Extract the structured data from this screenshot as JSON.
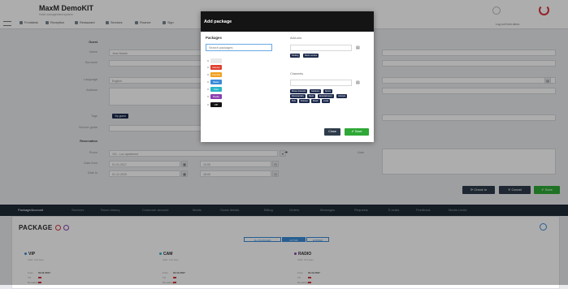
{
  "header": {
    "title": "MaxM DemoKIT",
    "subtitle": "Hotel management system",
    "nav": [
      "Frontdesk",
      "Reception",
      "Restaurant",
      "Services",
      "Finance",
      "Sign"
    ],
    "user_label": "Log out from demo"
  },
  "form": {
    "sections": {
      "guest": "Guest",
      "reservation": "Reservation"
    },
    "labels": {
      "name": "Name",
      "surname": "Surname",
      "language": "Language",
      "address": "Address",
      "tags": "Tags",
      "service_guide": "Service guide",
      "room": "Room",
      "date_from": "Date from",
      "date_to": "Date to",
      "note": "Note"
    },
    "values": {
      "name": "Jean Marek",
      "language": "English",
      "room": "101 - Lux apartment",
      "date_from": "01.01.2017",
      "date_to": "01.12.2020",
      "time_from": "12:00",
      "time_to": "18:00"
    },
    "tag_chip": "Vip guest"
  },
  "actions": {
    "checkin": "Check In",
    "cancel": "Cancel",
    "save": "Save"
  },
  "tabs": [
    "Package/Account",
    "Services",
    "Room history",
    "Customer account",
    "Meals",
    "Guest details",
    "Billing",
    "Orders",
    "Messages",
    "Requests",
    "E-mails",
    "Feedback",
    "Media Limits"
  ],
  "package": {
    "title": "PACKAGE",
    "filters": [
      "ALL PACKAGES",
      "ACTIVE",
      "EXPIRED"
    ],
    "cards": [
      {
        "name": "VIP",
        "color": "#3a8bd8",
        "sub": "Valid: 1/12 days",
        "rows": [
          {
            "k": "From",
            "v": "01.01.2017"
          },
          {
            "k": "TO"
          },
          {
            "k": "Remaining"
          }
        ]
      },
      {
        "name": "CAM",
        "color": "#2bb5c9",
        "sub": "Valid: 1/12 days",
        "rows": [
          {
            "k": "From",
            "v": "01.11.2017"
          },
          {
            "k": "TO"
          },
          {
            "k": "Remaining"
          }
        ]
      },
      {
        "name": "RADIO",
        "color": "#8b3fb0",
        "sub": "Valid: 1/12 days",
        "rows": [
          {
            "k": "From",
            "v": "01.11.2017"
          },
          {
            "k": "TO"
          },
          {
            "k": "Remaining"
          }
        ]
      }
    ]
  },
  "modal": {
    "title": "Add package",
    "packages_label": "Packages",
    "search_placeholder": "Search packages",
    "package_chips": [
      {
        "label": "",
        "color": "#e8e8e8"
      },
      {
        "label": "Deluxe",
        "color": "#e03e2d"
      },
      {
        "label": "Comfort",
        "color": "#f0a020"
      },
      {
        "label": "Basic",
        "color": "#3a8bd8"
      },
      {
        "label": "Cam",
        "color": "#2bb5c9"
      },
      {
        "label": "Radio",
        "color": "#8b3fb0"
      },
      {
        "label": "VIP",
        "color": "#141414"
      }
    ],
    "addons_label": "Add-ons",
    "addons_chips": [
      "Parking",
      "Room service"
    ],
    "channels_label": "Channels",
    "channels_chips": [
      "Movie channels",
      "Cartoons",
      "Sports",
      "Documentary",
      "News",
      "Entertainment",
      "Lifestyle",
      "Kids",
      "Science",
      "Music",
      "Local"
    ],
    "close": "Close",
    "save": "Save"
  }
}
